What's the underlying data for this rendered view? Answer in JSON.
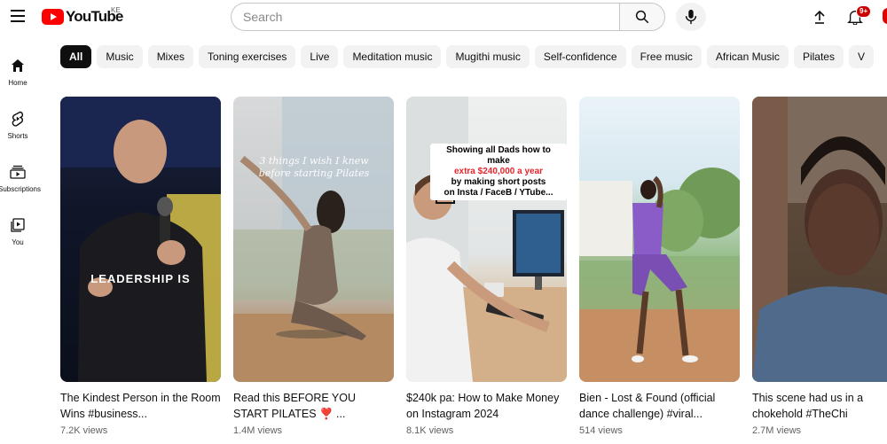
{
  "header": {
    "logo_text": "YouTube",
    "country_code": "KE",
    "search_placeholder": "Search",
    "notification_count": "9+"
  },
  "sidebar": {
    "items": [
      {
        "label": "Home",
        "icon": "home-icon"
      },
      {
        "label": "Shorts",
        "icon": "shorts-icon"
      },
      {
        "label": "Subscriptions",
        "icon": "subscriptions-icon"
      },
      {
        "label": "You",
        "icon": "you-icon"
      }
    ]
  },
  "chips": [
    "All",
    "Music",
    "Mixes",
    "Toning exercises",
    "Live",
    "Meditation music",
    "Mugithi music",
    "Self-confidence",
    "Free music",
    "African Music",
    "Pilates",
    "V"
  ],
  "videos": [
    {
      "title": "The Kindest Person in the Room Wins #business...",
      "views": "7.2K views",
      "overlay": "LEADERSHIP IS"
    },
    {
      "title": "Read this BEFORE YOU START PILATES ❣️ ...",
      "views": "1.4M views",
      "overlay": "3 things I wish I knew before starting Pilates"
    },
    {
      "title": "$240k pa: How to Make Money on Instagram 2024",
      "views": "8.1K views",
      "overlay_line1": "Showing all Dads how to make",
      "overlay_highlight": "extra $240,000 a year",
      "overlay_line3": "by making short posts",
      "overlay_line4": "on Insta / FaceB / YTube..."
    },
    {
      "title": "Bien - Lost & Found (official dance challenge) #viral...",
      "views": "514 views"
    },
    {
      "title": "This scene had us in a chokehold #TheChi",
      "views": "2.7M views"
    }
  ],
  "colors": {
    "brand_red": "#ff0000",
    "chip_active_bg": "#0f0f0f",
    "chip_bg": "#f2f2f2",
    "badge_red": "#cc0000"
  }
}
